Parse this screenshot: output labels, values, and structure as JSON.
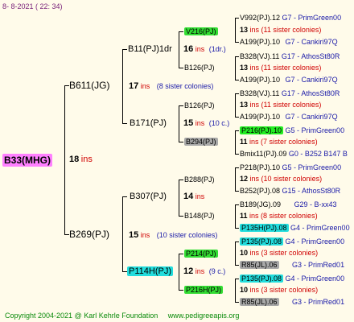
{
  "header": {
    "date": "8-  8-2021 ( 22: 34)"
  },
  "root": {
    "id": "B33(MHG)",
    "count": "18",
    "suffix": "ins"
  },
  "gen1": [
    {
      "id": "B611(JG)",
      "count": "17",
      "suffix": "ins",
      "note": "(8 sister colonies)"
    },
    {
      "id": "B269(PJ)",
      "count": "15",
      "suffix": "ins",
      "note": "(10 sister colonies)"
    }
  ],
  "gen2": [
    {
      "id": "B11(PJ)1dr",
      "count": "16",
      "suffix": "ins",
      "note": "(1dr.)"
    },
    {
      "id": "B171(PJ)",
      "count": "15",
      "suffix": "ins",
      "note": "(10 c.)"
    },
    {
      "id": "B307(PJ)",
      "count": "14",
      "suffix": "ins",
      "note": ""
    },
    {
      "id": "P114H(PJ)",
      "count": "12",
      "suffix": "ins",
      "note": "(9 c.)"
    }
  ],
  "gen3": [
    {
      "id": "V216(PJ)"
    },
    {
      "id": "B126(PJ)"
    },
    {
      "id": "B126(PJ)"
    },
    {
      "id": "B294(PJ)"
    },
    {
      "id": "B288(PJ)"
    },
    {
      "id": "B148(PJ)"
    },
    {
      "id": "P214(PJ)"
    },
    {
      "id": "P216H(PJ)"
    }
  ],
  "gen4": [
    {
      "a": "V992(PJ).12",
      "a_tag": "G7 - PrimGreen00",
      "count": "13",
      "note": "ins (11 sister colonies)",
      "b": "A199(PJ).10",
      "b_tag": "G7 - Cankiri97Q"
    },
    {
      "a": "B328(VJ).11",
      "a_tag": "G17 - AthosSt80R",
      "count": "13",
      "note": "ins (11 sister colonies)",
      "b": "A199(PJ).10",
      "b_tag": "G7 - Cankiri97Q"
    },
    {
      "a": "B328(VJ).11",
      "a_tag": "G17 - AthosSt80R",
      "count": "13",
      "note": "ins (11 sister colonies)",
      "b": "A199(PJ).10",
      "b_tag": "G7 - Cankiri97Q"
    },
    {
      "a": "P216(PJ).10",
      "a_tag": "G5 - PrimGreen00",
      "count": "11",
      "note": "ins (7 sister colonies)",
      "b": "Bmix11(PJ).09",
      "b_tag": "G0 - B252 B147 B"
    },
    {
      "a": "P218(PJ).10",
      "a_tag": "G5 - PrimGreen00",
      "count": "12",
      "note": "ins (10 sister colonies)",
      "b": "B252(PJ).08",
      "b_tag": "G15 - AthosSt80R"
    },
    {
      "a": "B189(JG).09",
      "a_tag": "G29 - B-xx43",
      "count": "11",
      "note": "ins (8 sister colonies)",
      "b": "P135H(PJ).08",
      "b_tag": "G4 - PrimGreen00"
    },
    {
      "a": "P135(PJ).08",
      "a_tag": "G4 - PrimGreen00",
      "count": "10",
      "note": "ins (3 sister colonies)",
      "b": "R85(JL).06",
      "b_tag": "G3 - PrimRed01"
    },
    {
      "a": "P135(PJ).08",
      "a_tag": "G4 - PrimGreen00",
      "count": "10",
      "note": "ins (3 sister colonies)",
      "b": "R85(JL).06",
      "b_tag": "G3 - PrimRed01"
    }
  ],
  "footer": {
    "copyright": "Copyright 2004-2021 @ Karl Kehrle Foundation",
    "url": "www.pedigreeapis.org"
  }
}
